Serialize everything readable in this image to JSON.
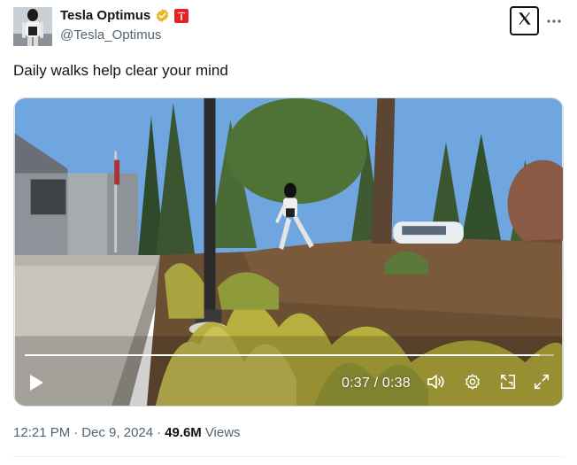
{
  "author": {
    "name": "Tesla Optimus",
    "handle": "@Tesla_Optimus",
    "verified_icon": "verified-badge-icon",
    "affiliation_icon": "tesla-logo-icon"
  },
  "header_actions": {
    "x_icon": "x-logo-icon",
    "more_icon": "more-horizontal-icon"
  },
  "tweet": {
    "text": "Daily walks help clear your mind"
  },
  "video": {
    "time_display": "0:37 / 0:38",
    "progress": 0.974,
    "controls": [
      "play-icon",
      "volume-icon",
      "settings-icon",
      "pip-icon",
      "fullscreen-icon"
    ]
  },
  "meta": {
    "time": "12:21 PM",
    "separator": "·",
    "date": "Dec 9, 2024",
    "separator2": "·",
    "views_count": "49.6M",
    "views_label": "Views"
  },
  "colors": {
    "text_primary": "#0f1419",
    "text_secondary": "#536471",
    "verified": "#e8b829",
    "tesla_red": "#e82127"
  }
}
